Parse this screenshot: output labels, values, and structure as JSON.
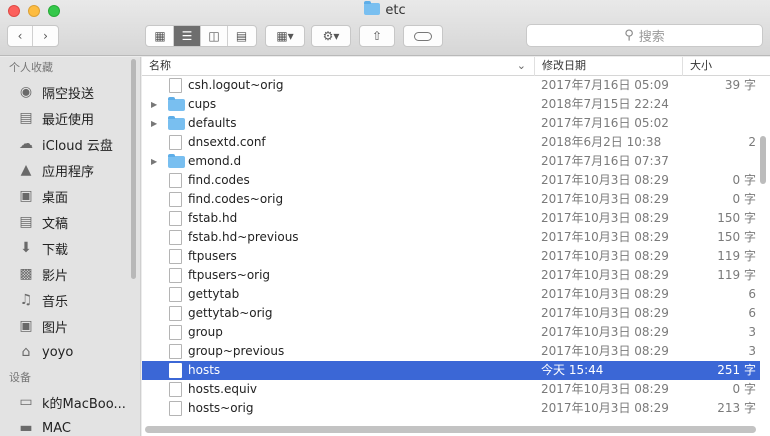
{
  "window": {
    "title": "etc"
  },
  "toolbar": {
    "back_icon": "chevron-left-icon",
    "forward_icon": "chevron-right-icon",
    "view_icons": [
      "icon-view-icon",
      "list-view-icon",
      "column-view-icon",
      "cover-flow-icon"
    ],
    "group_icon": "group-by-icon",
    "action_icon": "gear-icon",
    "share_icon": "share-icon",
    "tag_icon": "tag-icon"
  },
  "search": {
    "placeholder": "搜索"
  },
  "sidebar": {
    "favorites_header": "个人收藏",
    "favorites": [
      {
        "label": "隔空投送",
        "icon": "airdrop-icon"
      },
      {
        "label": "最近使用",
        "icon": "recents-icon"
      },
      {
        "label": "iCloud 云盘",
        "icon": "cloud-icon"
      },
      {
        "label": "应用程序",
        "icon": "applications-icon"
      },
      {
        "label": "桌面",
        "icon": "desktop-icon"
      },
      {
        "label": "文稿",
        "icon": "documents-icon"
      },
      {
        "label": "下载",
        "icon": "downloads-icon"
      },
      {
        "label": "影片",
        "icon": "movies-icon"
      },
      {
        "label": "音乐",
        "icon": "music-icon"
      },
      {
        "label": "图片",
        "icon": "pictures-icon"
      },
      {
        "label": "yoyo",
        "icon": "home-icon"
      }
    ],
    "devices_header": "设备",
    "devices": [
      {
        "label": "k的MacBoo...",
        "icon": "laptop-icon"
      },
      {
        "label": "MAC",
        "icon": "disk-icon"
      }
    ]
  },
  "columns": {
    "name": "名称",
    "date": "修改日期",
    "size": "大小"
  },
  "files": [
    {
      "name": "csh.logout~orig",
      "date": "2017年7月16日 05:09",
      "size": "39 字",
      "folder": false,
      "selected": false
    },
    {
      "name": "cups",
      "date": "2018年7月15日 22:24",
      "size": "",
      "folder": true,
      "selected": false
    },
    {
      "name": "defaults",
      "date": "2017年7月16日 05:02",
      "size": "",
      "folder": true,
      "selected": false
    },
    {
      "name": "dnsextd.conf",
      "date": "2018年6月2日 10:38",
      "size": "2",
      "folder": false,
      "selected": false
    },
    {
      "name": "emond.d",
      "date": "2017年7月16日 07:37",
      "size": "",
      "folder": true,
      "selected": false
    },
    {
      "name": "find.codes",
      "date": "2017年10月3日 08:29",
      "size": "0 字",
      "folder": false,
      "selected": false
    },
    {
      "name": "find.codes~orig",
      "date": "2017年10月3日 08:29",
      "size": "0 字",
      "folder": false,
      "selected": false
    },
    {
      "name": "fstab.hd",
      "date": "2017年10月3日 08:29",
      "size": "150 字",
      "folder": false,
      "selected": false
    },
    {
      "name": "fstab.hd~previous",
      "date": "2017年10月3日 08:29",
      "size": "150 字",
      "folder": false,
      "selected": false
    },
    {
      "name": "ftpusers",
      "date": "2017年10月3日 08:29",
      "size": "119 字",
      "folder": false,
      "selected": false
    },
    {
      "name": "ftpusers~orig",
      "date": "2017年10月3日 08:29",
      "size": "119 字",
      "folder": false,
      "selected": false
    },
    {
      "name": "gettytab",
      "date": "2017年10月3日 08:29",
      "size": "6",
      "folder": false,
      "selected": false
    },
    {
      "name": "gettytab~orig",
      "date": "2017年10月3日 08:29",
      "size": "6",
      "folder": false,
      "selected": false
    },
    {
      "name": "group",
      "date": "2017年10月3日 08:29",
      "size": "3",
      "folder": false,
      "selected": false
    },
    {
      "name": "group~previous",
      "date": "2017年10月3日 08:29",
      "size": "3",
      "folder": false,
      "selected": false
    },
    {
      "name": "hosts",
      "date": "今天 15:44",
      "size": "251 字",
      "folder": false,
      "selected": true
    },
    {
      "name": "hosts.equiv",
      "date": "2017年10月3日 08:29",
      "size": "0 字",
      "folder": false,
      "selected": false
    },
    {
      "name": "hosts~orig",
      "date": "2017年10月3日 08:29",
      "size": "213 字",
      "folder": false,
      "selected": false
    }
  ]
}
